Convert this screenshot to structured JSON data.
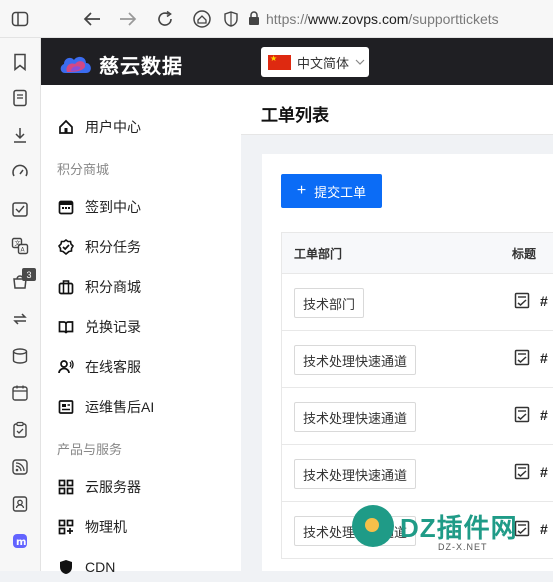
{
  "browser": {
    "url_scheme": "https://",
    "url_host": "www.zovps.com",
    "url_path": "/supporttickets"
  },
  "rail": {
    "badge_count": "3",
    "icons": [
      "bookmark-icon",
      "reading-list-icon",
      "download-icon",
      "performance-icon",
      "task-icon",
      "translate-icon",
      "badge-icon",
      "sync-icon",
      "database-icon",
      "calendar-icon",
      "clipboard-icon",
      "rss-icon",
      "contact-icon",
      "mastodon-icon"
    ]
  },
  "header": {
    "brand": "慈云数据",
    "language": "中文简体"
  },
  "sidebar": {
    "user_center": "用户中心",
    "group_points": "积分商城",
    "checkin": "签到中心",
    "tasks": "积分任务",
    "mall": "积分商城",
    "redeem": "兑换记录",
    "support": "在线客服",
    "ai": "运维售后AI",
    "group_products": "产品与服务",
    "cloud": "云服务器",
    "physical": "物理机",
    "cdn": "CDN"
  },
  "page": {
    "title": "工单列表",
    "submit_label": "提交工单"
  },
  "table": {
    "headers": [
      "工单部门",
      "标题"
    ],
    "rows": [
      {
        "dept": "技术部门",
        "id_prefix": "#"
      },
      {
        "dept": "技术处理快速通道",
        "id_prefix": "#"
      },
      {
        "dept": "技术处理快速通道",
        "id_prefix": "#"
      },
      {
        "dept": "技术处理快速通道",
        "id_prefix": "#"
      },
      {
        "dept": "技术处理快速通道",
        "id_prefix": "#"
      }
    ]
  },
  "watermark": {
    "text": "DZ插件网",
    "sub": "DZ-X.NET"
  },
  "colors": {
    "primary": "#0b6cf6",
    "dark_header": "#1f1f23",
    "watermark": "#1f9b87"
  }
}
